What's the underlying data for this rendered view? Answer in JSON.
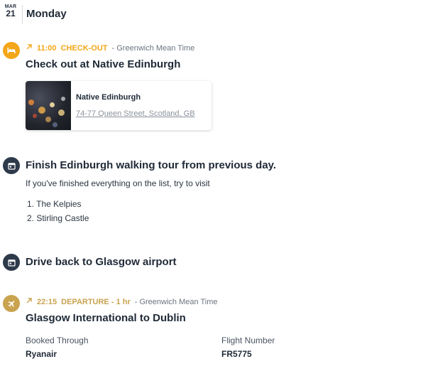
{
  "day": {
    "month": "MAR",
    "date": "21",
    "weekday": "Monday"
  },
  "events": [
    {
      "icon": "hotel-icon",
      "icon_color": "#f4a619",
      "time": "11:00",
      "label": "CHECK-OUT",
      "zone": "- Greenwich Mean Time",
      "accent": "#f4a619",
      "title": "Check out at Native Edinburgh",
      "card": {
        "name": "Native Edinburgh",
        "address": "74-77 Queen Street, Scotland, GB"
      }
    },
    {
      "icon": "calendar-icon",
      "icon_color": "#2d3a4a",
      "title": "Finish Edinburgh walking tour from previous day.",
      "description": "If you've finished everything on the list, try to visit",
      "list": [
        "1. The Kelpies",
        "2. Stirling Castle"
      ]
    },
    {
      "icon": "calendar-icon",
      "icon_color": "#2d3a4a",
      "title": "Drive back to Glasgow airport"
    },
    {
      "icon": "plane-icon",
      "icon_color": "#c9a34f",
      "time": "22:15",
      "label": "DEPARTURE - 1 hr",
      "zone": "- Greenwich Mean Time",
      "accent": "#c9a34f",
      "title": "Glasgow International to Dublin",
      "details": [
        {
          "label": "Booked Through",
          "value": "Ryanair"
        },
        {
          "label": "Flight Number",
          "value": "FR5775"
        }
      ]
    }
  ]
}
